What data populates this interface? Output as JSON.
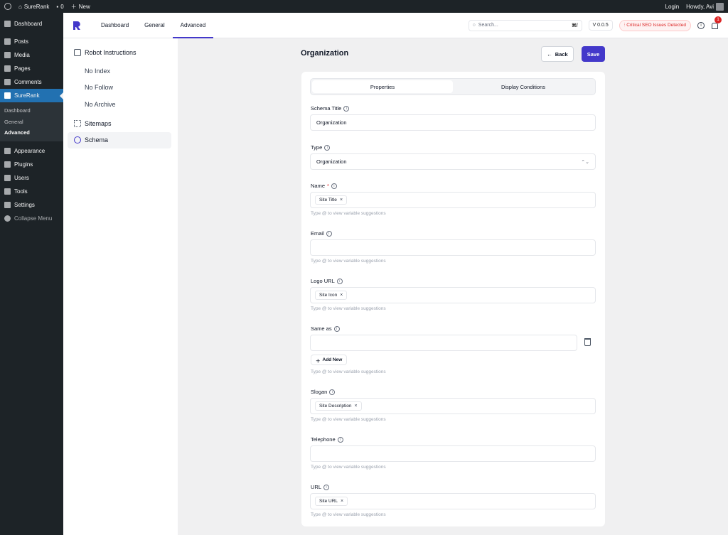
{
  "adminbar": {
    "site_name": "SureRank",
    "comments_count": "0",
    "new_label": "New",
    "login_label": "Login",
    "howdy": "Howdy, Avi"
  },
  "sidebar": {
    "items_top": [
      {
        "label": "Dashboard",
        "icon": "dashboard-icon"
      },
      {
        "label": "Posts",
        "icon": "pin-icon"
      },
      {
        "label": "Media",
        "icon": "media-icon"
      },
      {
        "label": "Pages",
        "icon": "page-icon"
      },
      {
        "label": "Comments",
        "icon": "comment-icon"
      },
      {
        "label": "SureRank",
        "icon": "surerank-icon"
      }
    ],
    "submenu": [
      "Dashboard",
      "General",
      "Advanced"
    ],
    "items_bottom": [
      {
        "label": "Appearance",
        "icon": "brush-icon"
      },
      {
        "label": "Plugins",
        "icon": "plug-icon"
      },
      {
        "label": "Users",
        "icon": "user-icon"
      },
      {
        "label": "Tools",
        "icon": "wrench-icon"
      },
      {
        "label": "Settings",
        "icon": "settings-icon"
      },
      {
        "label": "Collapse Menu",
        "icon": "collapse-icon"
      }
    ]
  },
  "header": {
    "tabs": [
      "Dashboard",
      "General",
      "Advanced"
    ],
    "search_placeholder": "Search...",
    "search_shortcut": "⌘/",
    "version": "V 0.0.5",
    "seo_badge": "Critical SEO Issues Detected",
    "notification_count": "1",
    "brand_color": "#4338ca"
  },
  "leftnav": {
    "robot": "Robot Instructions",
    "robot_subs": [
      "No Index",
      "No Follow",
      "No Archive"
    ],
    "sitemaps": "Sitemaps",
    "schema": "Schema"
  },
  "main": {
    "title": "Organization",
    "back_label": "Back",
    "save_label": "Save",
    "tabs": [
      "Properties",
      "Display Conditions"
    ],
    "hint": "Type @ to view variable suggestions",
    "fields": {
      "schema_title": {
        "label": "Schema Title",
        "value": "Organization"
      },
      "type": {
        "label": "Type",
        "value": "Organization"
      },
      "name": {
        "label": "Name",
        "required": "*",
        "chip": "Site Title"
      },
      "email": {
        "label": "Email"
      },
      "logo": {
        "label": "Logo URL",
        "chip": "Site Icon"
      },
      "same_as": {
        "label": "Same as",
        "add_new": "Add New"
      },
      "slogan": {
        "label": "Slogan",
        "chip": "Site Description"
      },
      "telephone": {
        "label": "Telephone"
      },
      "url": {
        "label": "URL",
        "chip": "Site URL"
      }
    }
  }
}
